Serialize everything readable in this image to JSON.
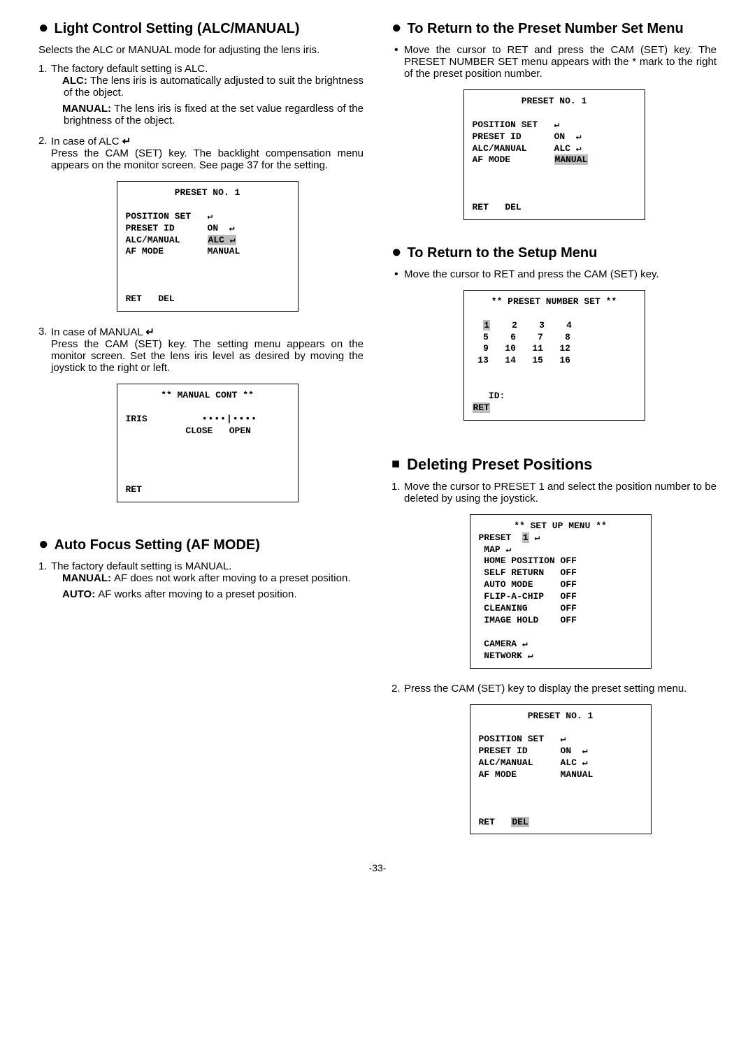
{
  "left": {
    "h1": "Light Control Setting (ALC/MANUAL)",
    "intro": "Selects the ALC or MANUAL mode for adjusting the lens iris.",
    "item1_lead": "The factory default setting is ALC.",
    "alc_label": "ALC:",
    "alc_text": "The lens iris is automatically adjusted to suit the brightness of the object.",
    "manual_label": "MANUAL:",
    "manual_text": "The lens iris is fixed at the set value regardless of the brightness of the object.",
    "item2_lead": "In case of ALC ",
    "item2_body": "Press the CAM (SET) key. The backlight compen­sation menu appears on the monitor screen. See page 37 for the setting.",
    "screen1": {
      "title": "PRESET NO. 1",
      "l1a": "POSITION SET",
      "l1b": "↵",
      "l2a": "PRESET ID",
      "l2b": "ON  ↵",
      "l3a": "ALC/MANUAL",
      "l3b": "ALC ↵",
      "l4a": "AF MODE",
      "l4b": "MANUAL",
      "ret": "RET",
      "del": "DEL"
    },
    "item3_lead": "In case of MANUAL ",
    "item3_body": "Press the CAM (SET) key. The setting menu appears on the monitor screen. Set the lens iris level as desired by moving the joystick to the right or left.",
    "screen2": {
      "title": "** MANUAL CONT **",
      "iris": "IRIS",
      "dots": "••••|••••",
      "close": "CLOSE",
      "open": "OPEN",
      "ret": "RET"
    },
    "h2": "Auto Focus Setting (AF MODE)",
    "af_item1": "The factory default setting is MANUAL.",
    "af_manual_label": "MANUAL:",
    "af_manual_text": "AF does not work after moving to a pre­set position.",
    "af_auto_label": "AUTO:",
    "af_auto_text": "AF works after moving to a preset position."
  },
  "right": {
    "h1": "To Return to the Preset Number Set Menu",
    "bul1": "Move the cursor to RET and press the CAM (SET) key. The PRESET NUMBER SET menu appears with the * mark to the right of the preset position number.",
    "screen1": {
      "title": "PRESET NO. 1",
      "l1a": "POSITION SET",
      "l1b": "↵",
      "l2a": "PRESET ID",
      "l2b": "ON  ↵",
      "l3a": "ALC/MANUAL",
      "l3b": "ALC ↵",
      "l4a": "AF MODE",
      "l4b": "MANUAL",
      "ret": "RET",
      "del": "DEL"
    },
    "h2": "To Return to the Setup Menu",
    "bul2": "Move the cursor to RET and press the CAM (SET) key.",
    "screen2": {
      "title": "** PRESET NUMBER SET **",
      "r1": " 1    2    3    4",
      "r2": " 5    6    7    8",
      "r3": " 9   10   11   12",
      "r4": "13   14   15   16",
      "id": "ID:",
      "ret": "RET"
    },
    "h3": "Deleting Preset Positions",
    "d_item1": "Move the cursor to PRESET 1 and select the posi­tion number to be deleted by using the joystick.",
    "screen3": {
      "title": "** SET UP MENU **",
      "l1a": "PRESET",
      "l1b": "1",
      "l1c": "↵",
      "l2": " MAP ↵",
      "l3a": " HOME POSITION",
      "l3b": "OFF",
      "l4a": " SELF RETURN",
      "l4b": "OFF",
      "l5a": " AUTO MODE",
      "l5b": "OFF",
      "l6a": " FLIP-A-CHIP",
      "l6b": "OFF",
      "l7a": " CLEANING",
      "l7b": "OFF",
      "l8a": " IMAGE HOLD",
      "l8b": "OFF",
      "l9": " CAMERA ↵",
      "l10": " NETWORK ↵"
    },
    "d_item2": "Press the CAM (SET) key to display the preset set­ting menu.",
    "screen4": {
      "title": "PRESET NO. 1",
      "l1a": "POSITION SET",
      "l1b": "↵",
      "l2a": "PRESET ID",
      "l2b": "ON  ↵",
      "l3a": "ALC/MANUAL",
      "l3b": "ALC ↵",
      "l4a": "AF MODE",
      "l4b": "MANUAL",
      "ret": "RET",
      "del": "DEL"
    }
  },
  "page": "-33-"
}
